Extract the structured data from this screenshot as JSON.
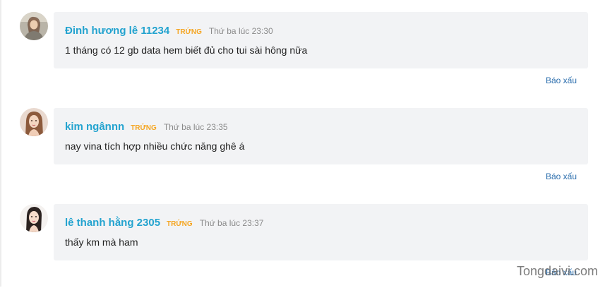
{
  "comments": [
    {
      "author": "Đinh hương lê 11234",
      "badge": "TRỨNG",
      "time": "Thứ ba lúc 23:30",
      "text": "1 tháng có 12 gb data hem biết đủ cho tui sài hông nữa",
      "report": "Báo xấu"
    },
    {
      "author": "kim ngânnn",
      "badge": "TRỨNG",
      "time": "Thứ ba lúc 23:35",
      "text": "nay vina tích hợp nhiều chức năng ghê á",
      "report": "Báo xấu"
    },
    {
      "author": "lê thanh hằng 2305",
      "badge": "TRỨNG",
      "time": "Thứ ba lúc 23:37",
      "text": "thấy km mà ham",
      "report": "Báo xấu"
    }
  ],
  "watermark": "Tongdaivi.com",
  "colors": {
    "author": "#23a3cf",
    "badge": "#f5a623",
    "time": "#8a8a8a",
    "bubble": "#f2f3f5",
    "report": "#2d6fae"
  }
}
